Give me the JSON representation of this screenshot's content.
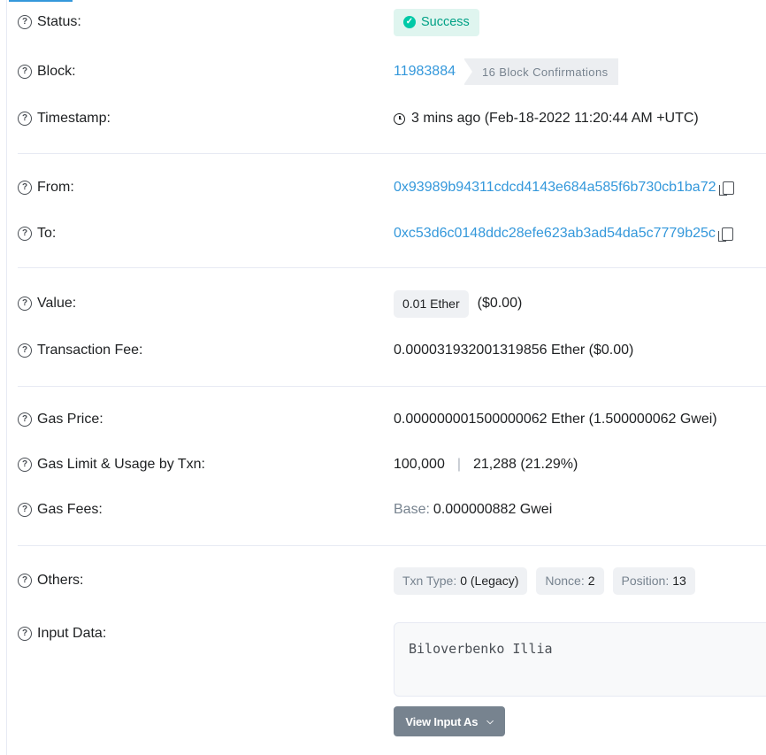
{
  "status": {
    "label": "Status:",
    "value": "Success"
  },
  "block": {
    "label": "Block:",
    "number": "11983884",
    "confirmations": "16 Block Confirmations"
  },
  "timestamp": {
    "label": "Timestamp:",
    "value": "3 mins ago (Feb-18-2022 11:20:44 AM +UTC)"
  },
  "from": {
    "label": "From:",
    "address": "0x93989b94311cdcd4143e684a585f6b730cb1ba72"
  },
  "to": {
    "label": "To:",
    "address": "0xc53d6c0148ddc28efe623ab3ad54da5c7779b25c"
  },
  "value": {
    "label": "Value:",
    "amount": "0.01 Ether",
    "usd": "($0.00)"
  },
  "fee": {
    "label": "Transaction Fee:",
    "value": "0.000031932001319856 Ether ($0.00)"
  },
  "gas_price": {
    "label": "Gas Price:",
    "value": "0.000000001500000062 Ether (1.500000062 Gwei)"
  },
  "gas_limit": {
    "label": "Gas Limit & Usage by Txn:",
    "limit": "100,000",
    "separator": "|",
    "usage": "21,288 (21.29%)"
  },
  "gas_fees": {
    "label": "Gas Fees:",
    "base_label": "Base:",
    "base_value": "0.000000882 Gwei"
  },
  "others": {
    "label": "Others:",
    "txn_type_label": "Txn Type:",
    "txn_type_value": "0 (Legacy)",
    "nonce_label": "Nonce:",
    "nonce_value": "2",
    "position_label": "Position:",
    "position_value": "13"
  },
  "input_data": {
    "label": "Input Data:",
    "text": "Biloverbenko Illia",
    "button": "View Input As"
  },
  "help_glyph": "?",
  "colors": {
    "link": "#3498db",
    "success": "#00a186",
    "button": "#77838f"
  }
}
